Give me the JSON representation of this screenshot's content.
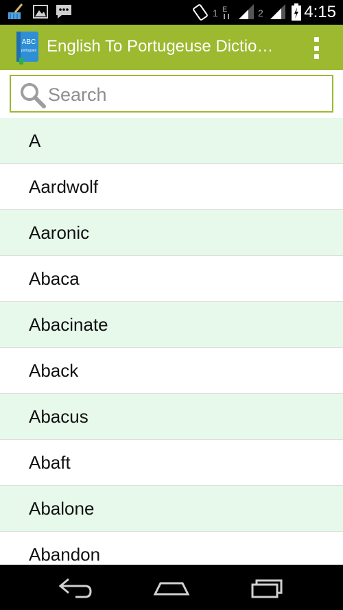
{
  "status_bar": {
    "time": "4:15",
    "sim1_label": "1",
    "sim2_label": "2",
    "icons": [
      "broom-icon",
      "image-icon",
      "chat-icon",
      "rotate-icon",
      "data-icon",
      "signal-icon",
      "signal-icon",
      "battery-icon"
    ]
  },
  "app": {
    "title": "English To Portugeuse Dictio…",
    "icon_label_top": "ABC",
    "icon_label_bottom": "portugues"
  },
  "search": {
    "placeholder": "Search",
    "value": ""
  },
  "words": [
    "A",
    "Aardwolf",
    "Aaronic",
    "Abaca",
    "Abacinate",
    "Aback",
    "Abacus",
    "Abaft",
    "Abalone",
    "Abandon"
  ],
  "colors": {
    "action_bar": "#9cb92f",
    "row_alt": "#e6f9ea",
    "search_border": "#9cb92f"
  },
  "nav_bar": {
    "buttons": [
      "back-icon",
      "home-icon",
      "recents-icon"
    ]
  }
}
